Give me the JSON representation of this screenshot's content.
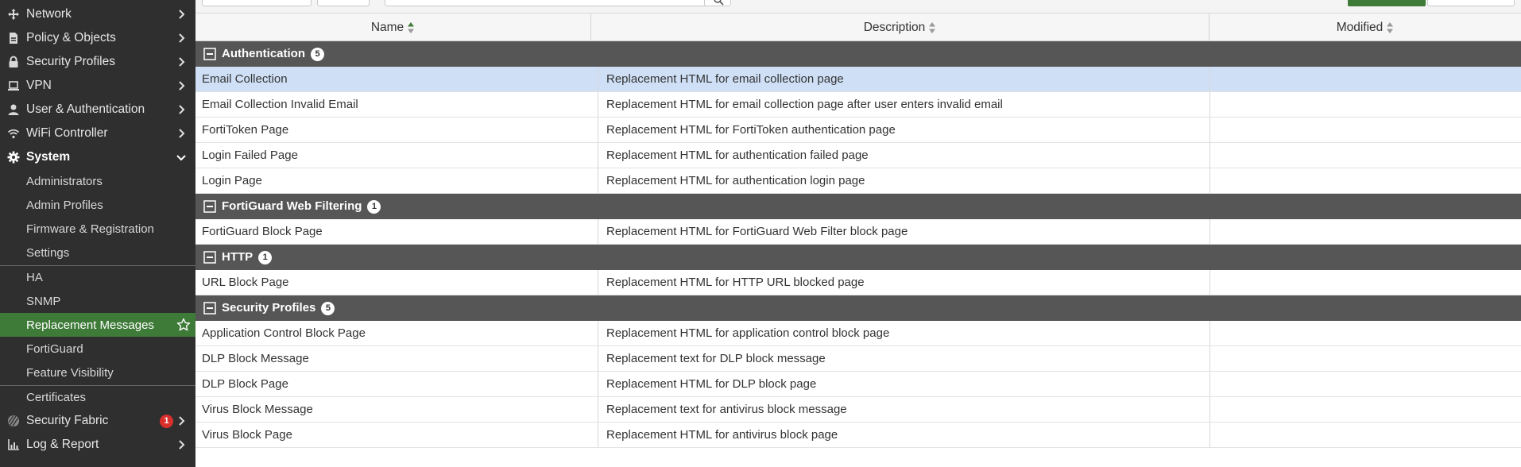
{
  "sidebar": {
    "items": [
      {
        "label": "Network",
        "icon": "network-icon"
      },
      {
        "label": "Policy & Objects",
        "icon": "policy-icon"
      },
      {
        "label": "Security Profiles",
        "icon": "lock-icon"
      },
      {
        "label": "VPN",
        "icon": "laptop-icon"
      },
      {
        "label": "User & Authentication",
        "icon": "user-icon"
      },
      {
        "label": "WiFi Controller",
        "icon": "wifi-icon"
      },
      {
        "label": "System",
        "icon": "gear-icon"
      }
    ],
    "system_subitems": [
      "Administrators",
      "Admin Profiles",
      "Firmware & Registration",
      "Settings",
      "HA",
      "SNMP",
      "Replacement Messages",
      "FortiGuard",
      "Feature Visibility",
      "Certificates"
    ],
    "bottom_items": [
      {
        "label": "Security Fabric",
        "icon": "fabric-icon",
        "badge": "1"
      },
      {
        "label": "Log & Report",
        "icon": "chart-icon"
      }
    ],
    "active_subitem": "Replacement Messages"
  },
  "table": {
    "columns": {
      "name": "Name",
      "description": "Description",
      "modified": "Modified"
    },
    "groups": [
      {
        "name": "Authentication",
        "count": "5",
        "rows": [
          {
            "name": "Email Collection",
            "description": "Replacement HTML for email collection page",
            "modified": "",
            "selected": true
          },
          {
            "name": "Email Collection Invalid Email",
            "description": "Replacement HTML for email collection page after user enters invalid email",
            "modified": ""
          },
          {
            "name": "FortiToken Page",
            "description": "Replacement HTML for FortiToken authentication page",
            "modified": ""
          },
          {
            "name": "Login Failed Page",
            "description": "Replacement HTML for authentication failed page",
            "modified": ""
          },
          {
            "name": "Login Page",
            "description": "Replacement HTML for authentication login page",
            "modified": ""
          }
        ]
      },
      {
        "name": "FortiGuard Web Filtering",
        "count": "1",
        "rows": [
          {
            "name": "FortiGuard Block Page",
            "description": "Replacement HTML for FortiGuard Web Filter block page",
            "modified": ""
          }
        ]
      },
      {
        "name": "HTTP",
        "count": "1",
        "rows": [
          {
            "name": "URL Block Page",
            "description": "Replacement HTML for HTTP URL blocked page",
            "modified": ""
          }
        ]
      },
      {
        "name": "Security Profiles",
        "count": "5",
        "rows": [
          {
            "name": "Application Control Block Page",
            "description": "Replacement HTML for application control block page",
            "modified": ""
          },
          {
            "name": "DLP Block Message",
            "description": "Replacement text for DLP block message",
            "modified": ""
          },
          {
            "name": "DLP Block Page",
            "description": "Replacement HTML for DLP block page",
            "modified": ""
          },
          {
            "name": "Virus Block Message",
            "description": "Replacement text for antivirus block message",
            "modified": ""
          },
          {
            "name": "Virus Block Page",
            "description": "Replacement HTML for antivirus block page",
            "modified": ""
          }
        ]
      }
    ]
  },
  "colors": {
    "sidebar_bg": "#2f2f2f",
    "active_green": "#3e7a38",
    "group_header_bg": "#565656",
    "selected_row_bg": "#cfe0f6",
    "badge_red": "#d9302c"
  }
}
